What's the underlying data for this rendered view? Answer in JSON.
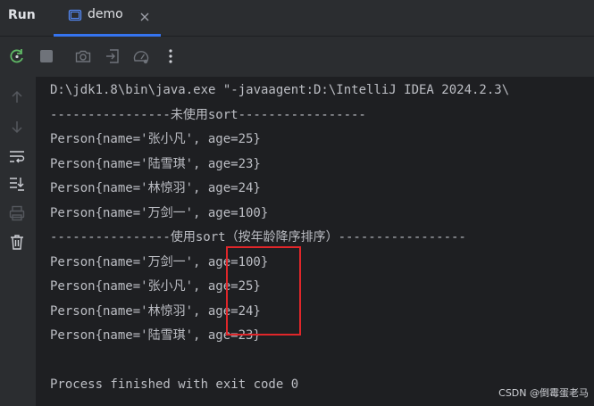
{
  "run_panel": {
    "title": "Run",
    "tab": {
      "label": "demo"
    }
  },
  "toolbar": {
    "icons": [
      "rerun-icon",
      "stop-icon",
      "camera-icon",
      "exit-icon",
      "gauge-icon",
      "more-icon"
    ]
  },
  "sidebar": {
    "icons": [
      "arrow-up-icon",
      "arrow-down-icon",
      "soft-wrap-icon",
      "scroll-to-end-icon",
      "print-icon",
      "trash-icon"
    ]
  },
  "console": {
    "lines": [
      "D:\\jdk1.8\\bin\\java.exe \"-javaagent:D:\\IntelliJ IDEA 2024.2.3\\",
      "----------------未使用sort-----------------",
      "Person{name='张小凡', age=25}",
      "Person{name='陆雪琪', age=23}",
      "Person{name='林惊羽', age=24}",
      "Person{name='万剑一', age=100}",
      "----------------使用sort（按年龄降序排序）-----------------",
      "Person{name='万剑一', age=100}",
      "Person{name='张小凡', age=25}",
      "Person{name='林惊羽', age=24}",
      "Person{name='陆雪琪', age=23}",
      "",
      "Process finished with exit code 0"
    ]
  },
  "watermark": "CSDN @倒霉蛋老马",
  "colors": {
    "background": "#1e1f22",
    "panel": "#2b2d30",
    "text": "#bcbec4",
    "accent": "#3574f0",
    "highlight_border": "#e0262a"
  }
}
